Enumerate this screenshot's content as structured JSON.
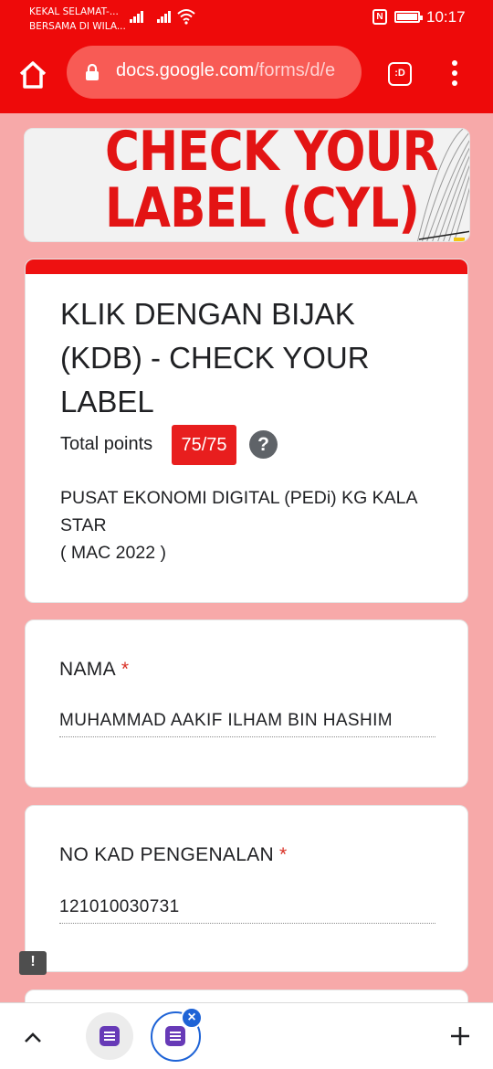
{
  "status_bar": {
    "carrier_line1": "KEKAL SELAMAT-...",
    "carrier_line2": "BERSAMA DI WILA...",
    "time": "10:17",
    "nfc": "N"
  },
  "browser": {
    "url_host": "docs.google.com",
    "url_path": "/forms/d/e",
    "tab_label": ":D"
  },
  "banner": {
    "line1": "CHECK YOUR",
    "line2": "LABEL (CYL)"
  },
  "form": {
    "title": "KLIK DENGAN BIJAK (KDB) - CHECK YOUR LABEL",
    "points_label": "Total points",
    "points_value": "75/75",
    "help": "?",
    "desc_line1": "PUSAT EKONOMI DIGITAL (PEDi) KG KALA STAR",
    "desc_line2": "( MAC 2022 )"
  },
  "questions": [
    {
      "label": "NAMA",
      "required": "*",
      "answer": "MUHAMMAD AAKIF ILHAM BIN HASHIM"
    },
    {
      "label": "NO KAD PENGENALAN",
      "required": "*",
      "answer": "121010030731"
    }
  ],
  "feedback": {
    "label": "!"
  },
  "bottom_bar": {
    "close": "×"
  },
  "colors": {
    "accent": "#ee0a0a",
    "background": "#f7a9a9",
    "badge": "#e81e1e",
    "active_tab": "#1e63d6",
    "forms_purple": "#673ab7"
  }
}
